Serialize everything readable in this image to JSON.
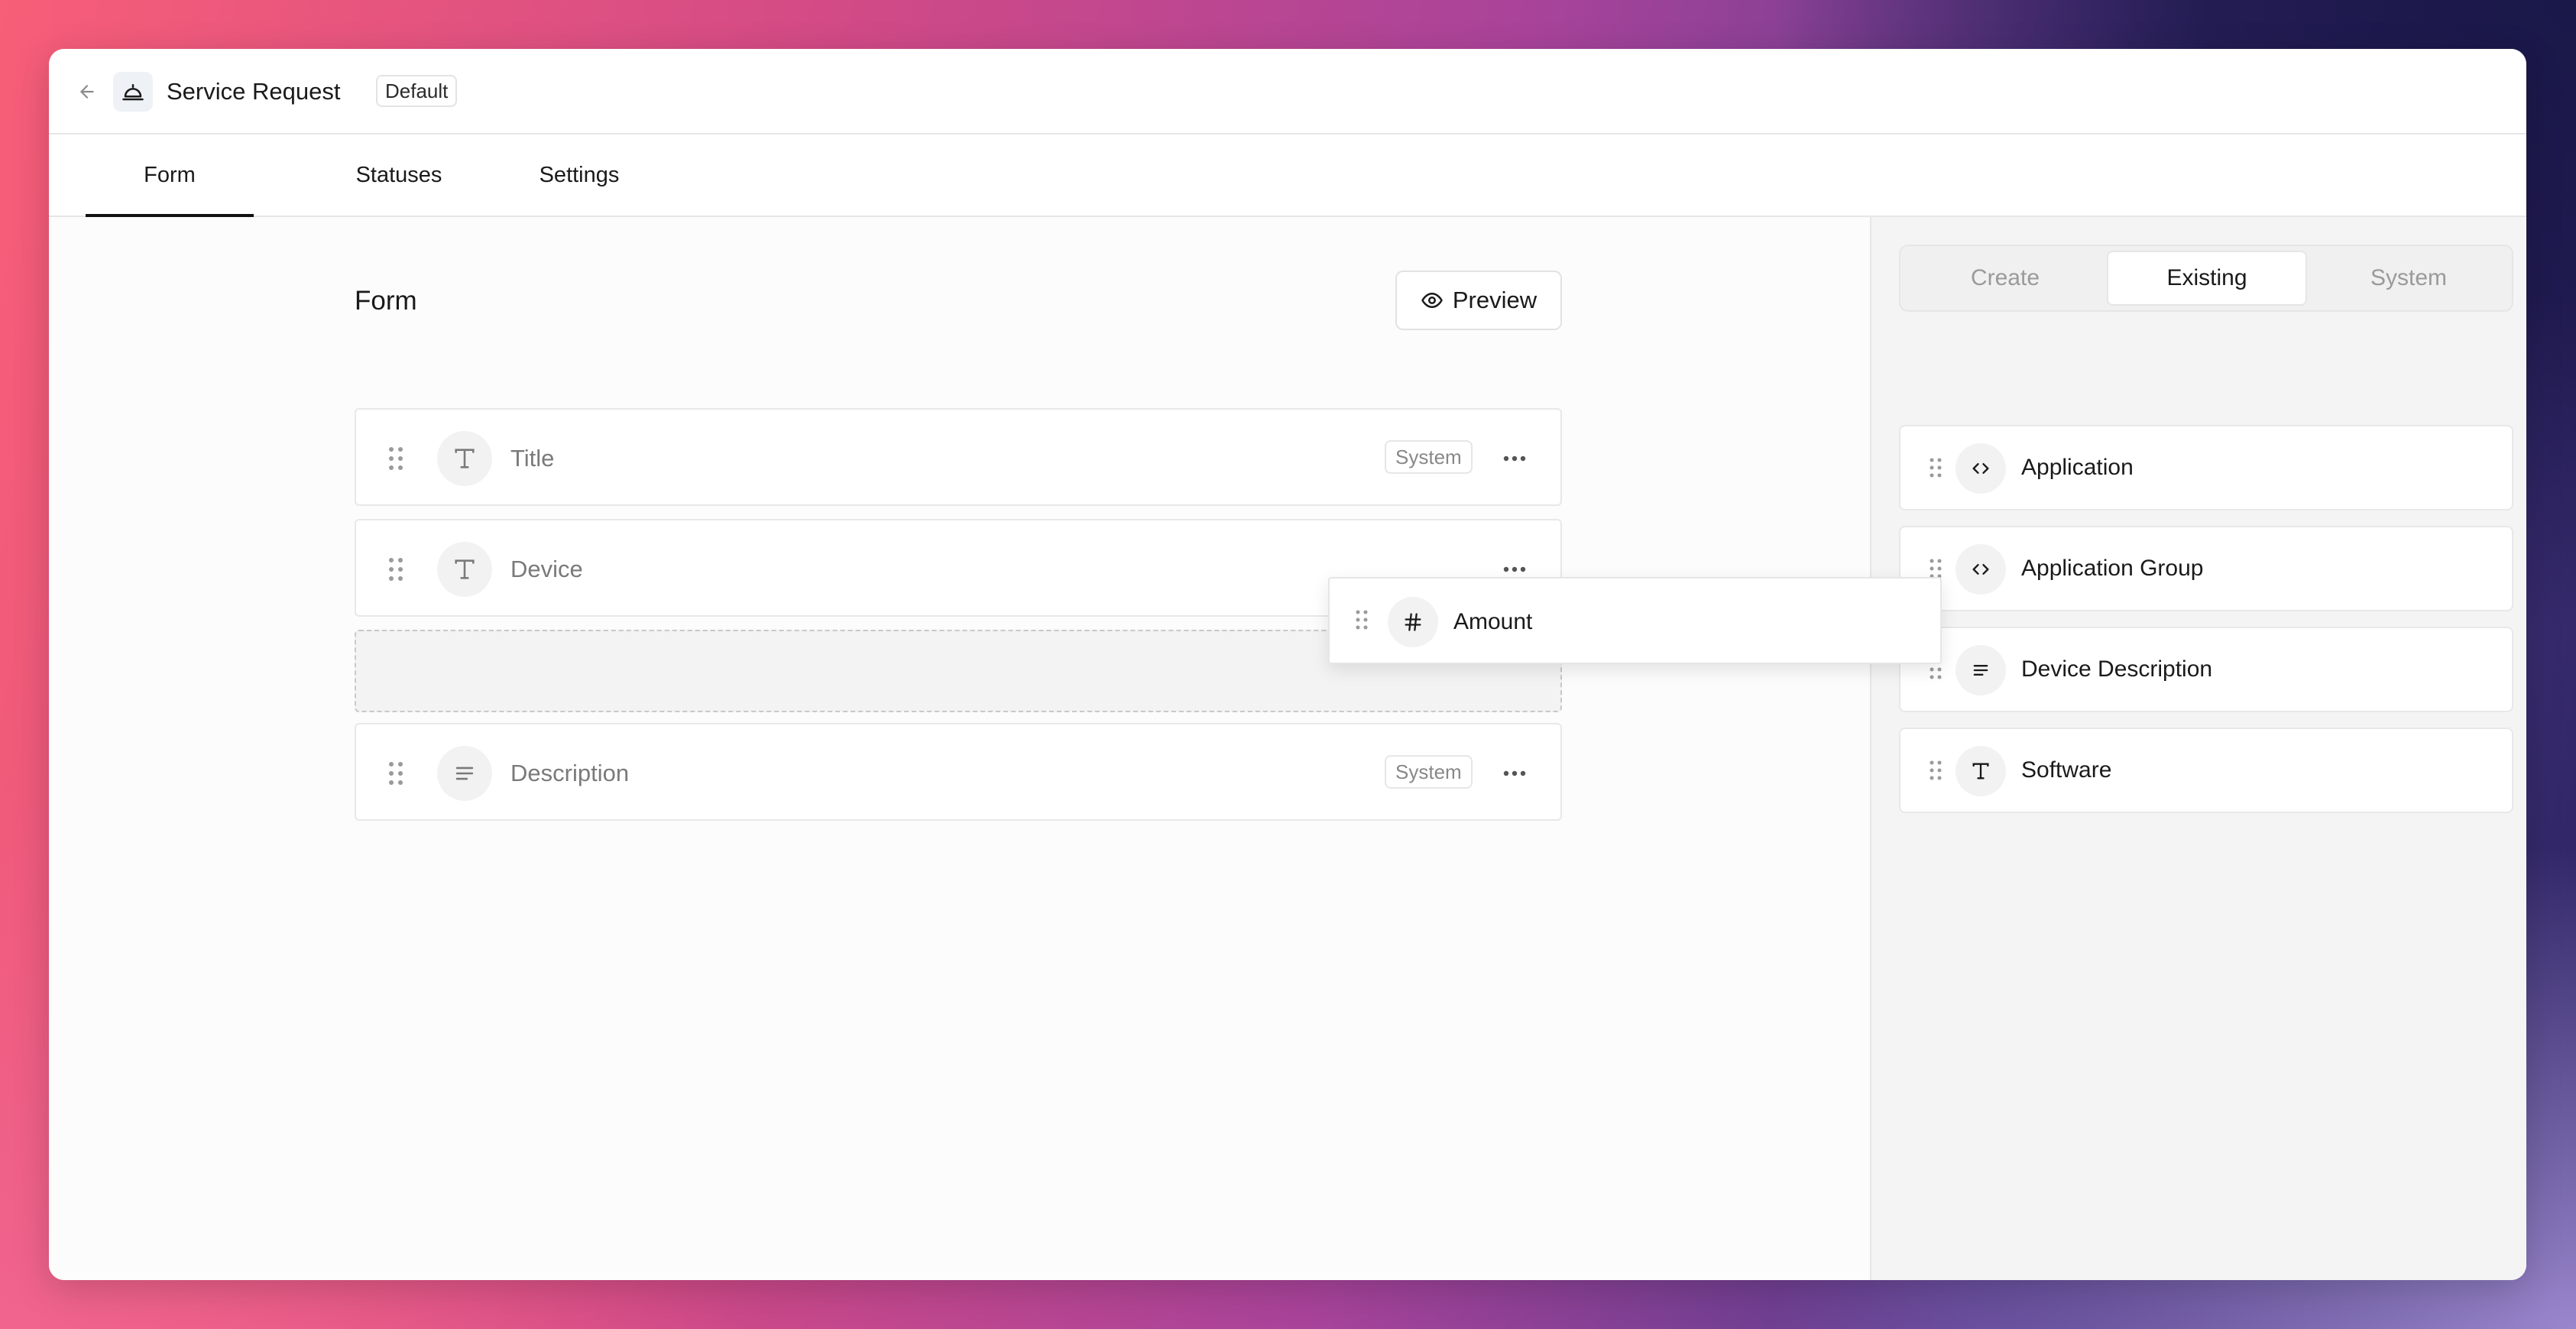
{
  "header": {
    "title": "Service Request",
    "badge": "Default"
  },
  "tabs": [
    {
      "label": "Form",
      "active": true
    },
    {
      "label": "Statuses",
      "active": false
    },
    {
      "label": "Settings",
      "active": false
    }
  ],
  "form": {
    "heading": "Form",
    "preview_label": "Preview",
    "fields": [
      {
        "label": "Title",
        "icon": "text-type-icon",
        "badge": "System"
      },
      {
        "label": "Device",
        "icon": "text-type-icon",
        "badge": ""
      },
      {
        "label": "Description",
        "icon": "paragraph-type-icon",
        "badge": "System"
      }
    ]
  },
  "dragging": {
    "label": "Amount",
    "icon": "number-type-icon"
  },
  "side_panel": {
    "segments": [
      {
        "label": "Create",
        "active": false
      },
      {
        "label": "Existing",
        "active": true
      },
      {
        "label": "System",
        "active": false
      }
    ],
    "fields": [
      {
        "label": "Application",
        "icon": "code-type-icon"
      },
      {
        "label": "Application Group",
        "icon": "code-type-icon"
      },
      {
        "label": "Device Description",
        "icon": "paragraph-type-icon"
      },
      {
        "label": "Software",
        "icon": "text-type-icon"
      }
    ]
  }
}
